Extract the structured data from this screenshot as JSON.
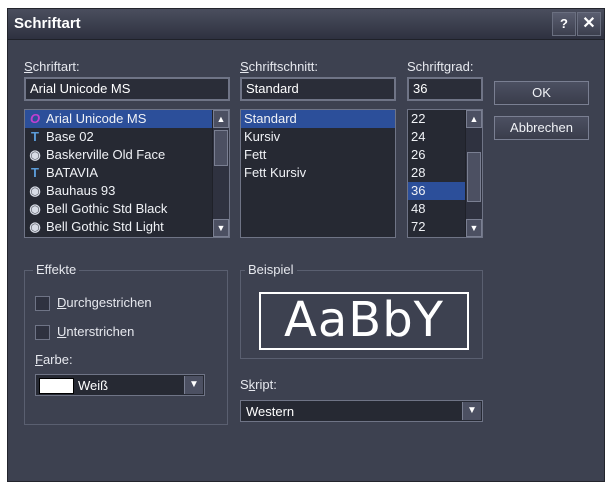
{
  "window": {
    "title": "Schriftart",
    "help_label": "?",
    "close_label": "✕"
  },
  "font": {
    "label": "Schriftart:",
    "value": "Arial Unicode MS",
    "items": [
      {
        "label": "Arial Unicode MS",
        "icon": "O",
        "icon_name": "opentype-font-icon",
        "selected": true
      },
      {
        "label": "Base 02",
        "icon": "T",
        "icon_name": "truetype-font-icon"
      },
      {
        "label": "Baskerville Old Face",
        "icon": "◉",
        "icon_name": "system-font-icon"
      },
      {
        "label": "BATAVIA",
        "icon": "T",
        "icon_name": "truetype-font-icon"
      },
      {
        "label": "Bauhaus 93",
        "icon": "◉",
        "icon_name": "system-font-icon"
      },
      {
        "label": "Bell Gothic Std Black",
        "icon": "◉",
        "icon_name": "system-font-icon"
      },
      {
        "label": "Bell Gothic Std Light",
        "icon": "◉",
        "icon_name": "system-font-icon"
      }
    ]
  },
  "style": {
    "label": "Schriftschnitt:",
    "value": "Standard",
    "items": [
      "Standard",
      "Kursiv",
      "Fett",
      "Fett Kursiv"
    ],
    "selected_index": 0
  },
  "size": {
    "label": "Schriftgrad:",
    "value": "36",
    "items": [
      "22",
      "24",
      "26",
      "28",
      "36",
      "48",
      "72"
    ],
    "selected_index": 4
  },
  "buttons": {
    "ok": "OK",
    "cancel": "Abbrechen"
  },
  "effects": {
    "label": "Effekte",
    "strikethrough": "Durchgestrichen",
    "underline": "Unterstrichen",
    "strikethrough_checked": false,
    "underline_checked": false,
    "color_label": "Farbe:",
    "color_value": "Weiß",
    "color_swatch": "#ffffff"
  },
  "sample": {
    "label": "Beispiel",
    "text": "AaBbY"
  },
  "script": {
    "label": "Skript:",
    "value": "Western"
  },
  "colors": {
    "accent": "#2c4f9a",
    "background": "#3d4150"
  }
}
